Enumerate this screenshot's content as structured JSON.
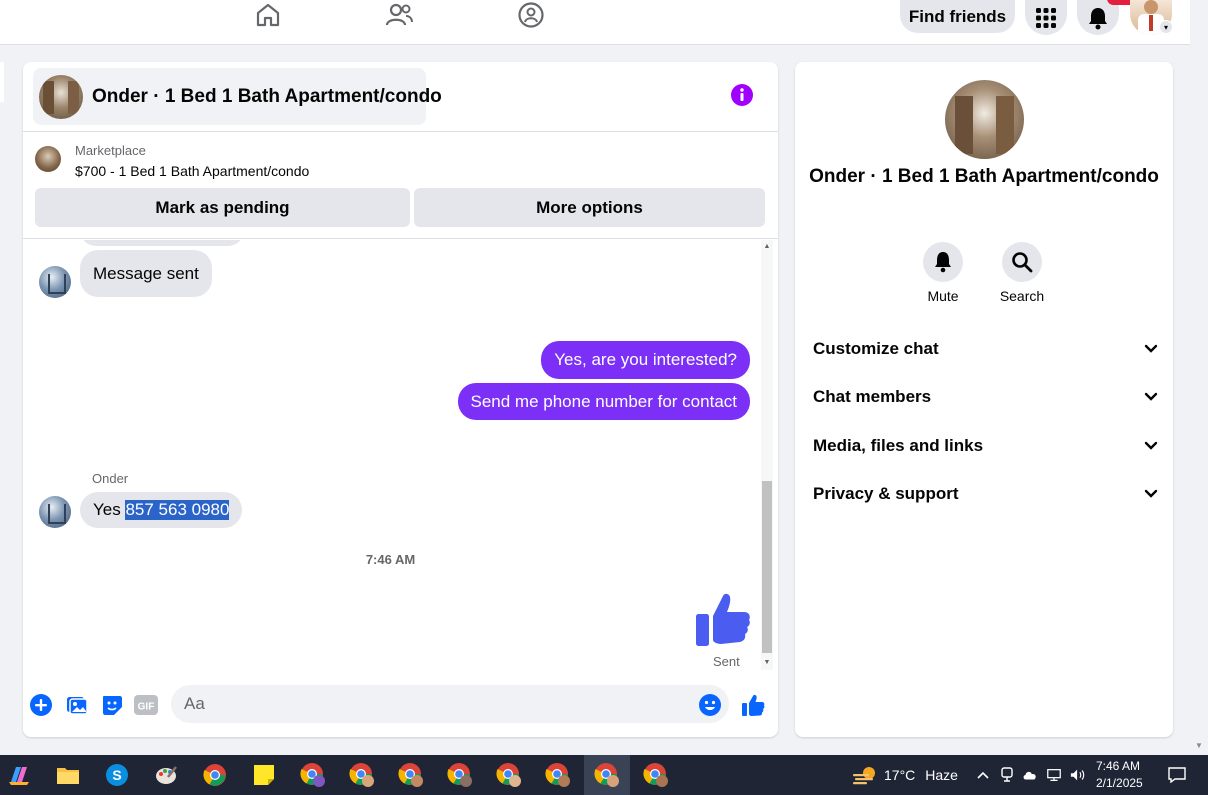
{
  "topnav": {
    "find_friends_label": "Find friends"
  },
  "chat": {
    "header_title": "Onder · 1 Bed 1 Bath Apartment/condo",
    "marketplace_label": "Marketplace",
    "listing_title": "$700 - 1 Bed 1 Bath Apartment/condo",
    "mark_pending_label": "Mark as pending",
    "more_options_label": "More options",
    "messages": {
      "incoming_1": "Message sent",
      "outgoing_1": "Yes, are you interested?",
      "outgoing_2": "Send me phone number for contact",
      "sender_name": "Onder",
      "incoming_2_prefix": "Yes ",
      "incoming_2_selected": "857 563 0980",
      "timestamp": "7:46 AM",
      "sent_status": "Sent"
    },
    "composer_placeholder": "Aa",
    "composer_gif_label": "GIF"
  },
  "info_panel": {
    "name": "Onder · 1 Bed 1 Bath Apartment/condo",
    "mute_label": "Mute",
    "search_label": "Search",
    "sections": [
      "Customize chat",
      "Chat members",
      "Media, files and links",
      "Privacy & support"
    ]
  },
  "taskbar": {
    "temperature": "17°C",
    "weather": "Haze",
    "time": "7:46 AM",
    "date": "2/1/2025"
  },
  "colors": {
    "accent": "#7b2ff7",
    "messenger_blue": "#0866ff",
    "like_blue": "#4b5cf0",
    "notification_red": "#e41e3f"
  }
}
